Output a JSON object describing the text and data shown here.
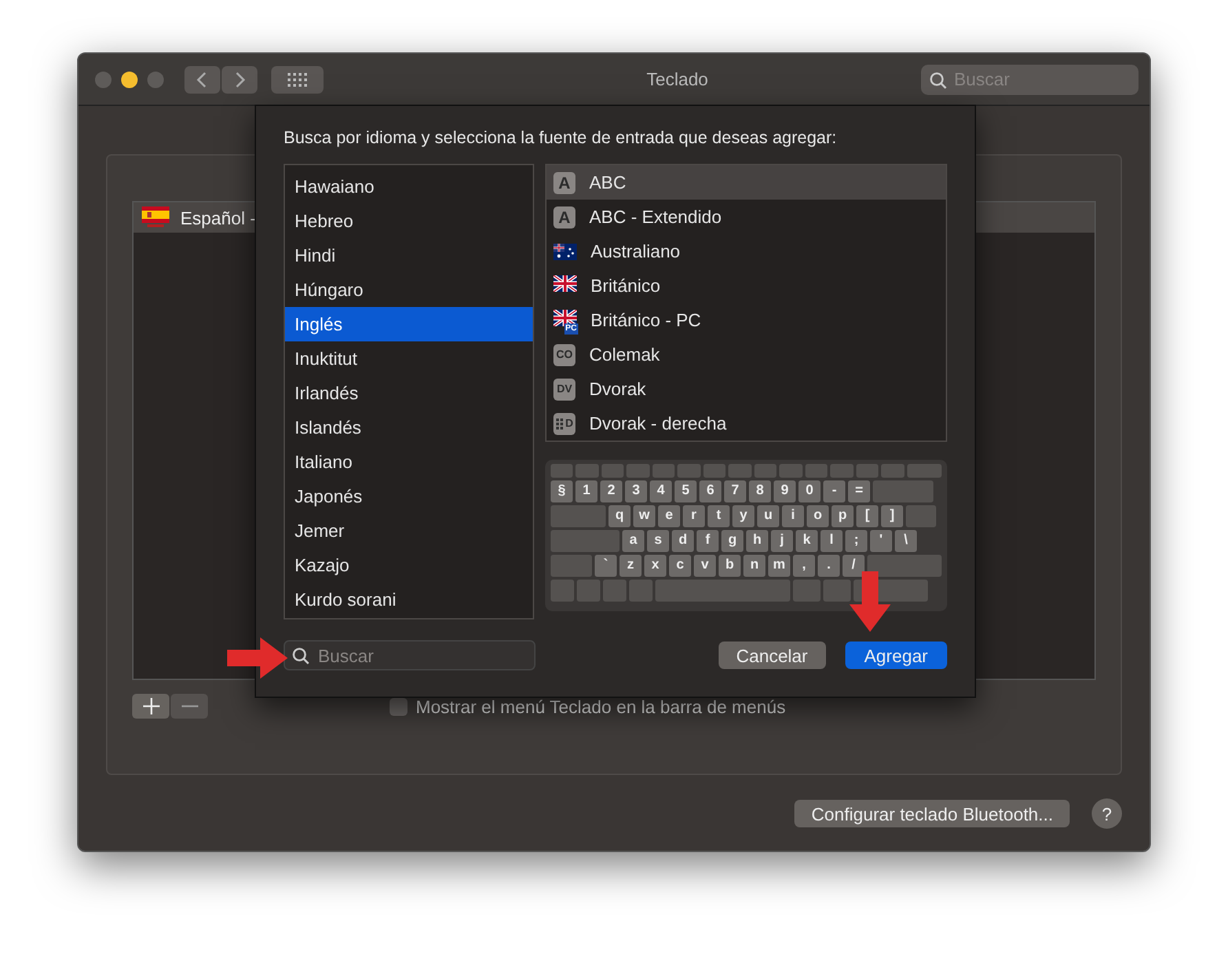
{
  "window": {
    "title": "Teclado",
    "search": {
      "placeholder": "Buscar"
    }
  },
  "sources": [
    {
      "name": "Español -"
    }
  ],
  "show_menu": {
    "label": "Mostrar el menú Teclado en la barra de menús",
    "checked": false
  },
  "bluetooth_button": "Configurar teclado Bluetooth...",
  "help_button": "?",
  "sheet": {
    "prompt": "Busca por idioma y selecciona la fuente de entrada que deseas agregar:",
    "languages": [
      {
        "label": "Hawaiano",
        "selected": false
      },
      {
        "label": "Hebreo",
        "selected": false
      },
      {
        "label": "Hindi",
        "selected": false
      },
      {
        "label": "Húngaro",
        "selected": false
      },
      {
        "label": "Inglés",
        "selected": true
      },
      {
        "label": "Inuktitut",
        "selected": false
      },
      {
        "label": "Irlandés",
        "selected": false
      },
      {
        "label": "Islandés",
        "selected": false
      },
      {
        "label": "Italiano",
        "selected": false
      },
      {
        "label": "Japonés",
        "selected": false
      },
      {
        "label": "Jemer",
        "selected": false
      },
      {
        "label": "Kazajo",
        "selected": false
      },
      {
        "label": "Kurdo sorani",
        "selected": false
      }
    ],
    "layouts": [
      {
        "label": "ABC",
        "kind": "badge",
        "badge": "A",
        "selected": true
      },
      {
        "label": "ABC - Extendido",
        "kind": "badge",
        "badge": "A",
        "selected": false
      },
      {
        "label": "Australiano",
        "kind": "flag-au",
        "selected": false
      },
      {
        "label": "Británico",
        "kind": "flag-uk",
        "selected": false
      },
      {
        "label": "Británico - PC",
        "kind": "flag-uk-pc",
        "badge": "PC",
        "selected": false
      },
      {
        "label": "Colemak",
        "kind": "badge",
        "badge": "CO",
        "selected": false
      },
      {
        "label": "Dvorak",
        "kind": "badge",
        "badge": "DV",
        "selected": false
      },
      {
        "label": "Dvorak - derecha",
        "kind": "dots",
        "badge": "D",
        "selected": false
      }
    ],
    "keyboard": [
      [
        "§",
        "1",
        "2",
        "3",
        "4",
        "5",
        "6",
        "7",
        "8",
        "9",
        "0",
        "-",
        "="
      ],
      [
        "q",
        "w",
        "e",
        "r",
        "t",
        "y",
        "u",
        "i",
        "o",
        "p",
        "[",
        "]"
      ],
      [
        "a",
        "s",
        "d",
        "f",
        "g",
        "h",
        "j",
        "k",
        "l",
        ";",
        "'",
        "\\"
      ],
      [
        "`",
        "z",
        "x",
        "c",
        "v",
        "b",
        "n",
        "m",
        ",",
        ".",
        "/"
      ]
    ],
    "search": {
      "placeholder": "Buscar"
    },
    "buttons": [
      {
        "label": "Cancelar",
        "kind": "secondary"
      },
      {
        "label": "Agregar",
        "kind": "primary"
      }
    ]
  }
}
